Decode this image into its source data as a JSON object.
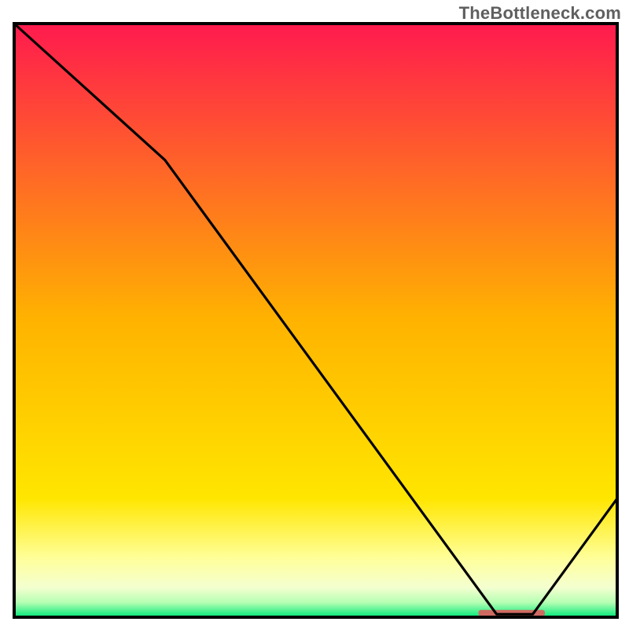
{
  "watermark": "TheBottleneck.com",
  "chart_data": {
    "type": "line",
    "title": "",
    "xlabel": "",
    "ylabel": "",
    "xlim": [
      0,
      100
    ],
    "ylim": [
      0,
      100
    ],
    "grid": false,
    "legend": false,
    "series": [
      {
        "name": "bottleneck-curve",
        "color": "#000000",
        "x": [
          0,
          25,
          80,
          86,
          100
        ],
        "values": [
          100,
          77,
          0.5,
          0.5,
          20
        ]
      }
    ],
    "marker": {
      "name": "optimal-range",
      "color": "#cf6a61",
      "x_start": 77,
      "x_end": 88,
      "y": 0.7
    },
    "background_gradient": {
      "stops": [
        {
          "offset": 0.0,
          "color": "#ff1a4e"
        },
        {
          "offset": 0.5,
          "color": "#ffb300"
        },
        {
          "offset": 0.8,
          "color": "#ffe600"
        },
        {
          "offset": 0.9,
          "color": "#ffff99"
        },
        {
          "offset": 0.95,
          "color": "#f4ffd0"
        },
        {
          "offset": 0.975,
          "color": "#b6ffb3"
        },
        {
          "offset": 1.0,
          "color": "#00e878"
        }
      ]
    },
    "frame_color": "#000000"
  }
}
